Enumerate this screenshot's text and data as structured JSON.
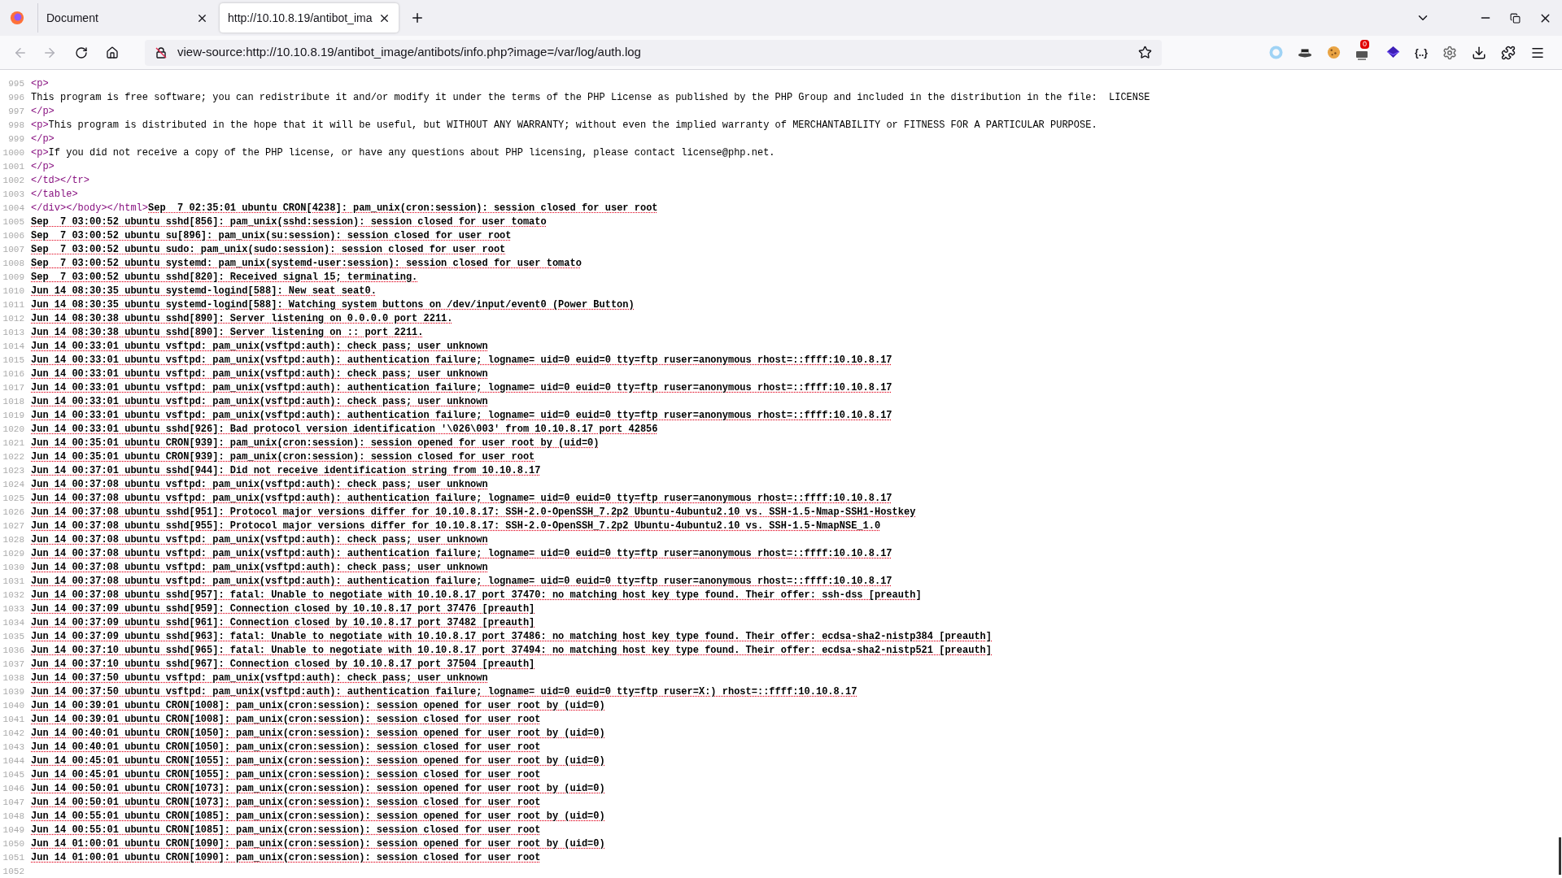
{
  "tabs": [
    {
      "title": "Document",
      "selected": false
    },
    {
      "title": "http://10.10.8.19/antibot_ima",
      "selected": true
    }
  ],
  "address_bar": {
    "url": "view-source:http://10.10.8.19/antibot_image/antibots/info.php?image=/var/log/auth.log"
  },
  "extensions": {
    "badge": "0",
    "json_label": "{..}"
  },
  "source_lines": [
    {
      "number": "995",
      "parts": [
        {
          "kind": "tag",
          "text": "<p>"
        }
      ]
    },
    {
      "number": "996",
      "parts": [
        {
          "kind": "text",
          "text": "This program is free software; you can redistribute it and/or modify it under the terms of the PHP License as published by the PHP Group and included in the distribution in the file:  LICENSE"
        }
      ]
    },
    {
      "number": "997",
      "parts": [
        {
          "kind": "tag",
          "text": "</p>"
        }
      ]
    },
    {
      "number": "998",
      "parts": [
        {
          "kind": "tag",
          "text": "<p>"
        },
        {
          "kind": "text",
          "text": "This program is distributed in the hope that it will be useful, but WITHOUT ANY WARRANTY; without even the implied warranty of MERCHANTABILITY or FITNESS FOR A PARTICULAR PURPOSE."
        }
      ]
    },
    {
      "number": "999",
      "parts": [
        {
          "kind": "tag",
          "text": "</p>"
        }
      ]
    },
    {
      "number": "1000",
      "parts": [
        {
          "kind": "tag",
          "text": "<p>"
        },
        {
          "kind": "text",
          "text": "If you did not receive a copy of the PHP license, or have any questions about PHP licensing, please contact license@php.net."
        }
      ]
    },
    {
      "number": "1001",
      "parts": [
        {
          "kind": "tag",
          "text": "</p>"
        }
      ]
    },
    {
      "number": "1002",
      "parts": [
        {
          "kind": "tag",
          "text": "</td></tr>"
        }
      ]
    },
    {
      "number": "1003",
      "parts": [
        {
          "kind": "tag",
          "text": "</table>"
        }
      ]
    },
    {
      "number": "1004",
      "parts": [
        {
          "kind": "tag",
          "text": "</div></body></html>"
        },
        {
          "kind": "error",
          "text": "Sep  7 02:35:01 ubuntu CRON[4238]: pam_unix(cron:session): session closed for user root"
        }
      ]
    },
    {
      "number": "1005",
      "parts": [
        {
          "kind": "error",
          "text": "Sep  7 03:00:52 ubuntu sshd[856]: pam_unix(sshd:session): session closed for user tomato"
        }
      ]
    },
    {
      "number": "1006",
      "parts": [
        {
          "kind": "error",
          "text": "Sep  7 03:00:52 ubuntu su[896]: pam_unix(su:session): session closed for user root"
        }
      ]
    },
    {
      "number": "1007",
      "parts": [
        {
          "kind": "error",
          "text": "Sep  7 03:00:52 ubuntu sudo: pam_unix(sudo:session): session closed for user root"
        }
      ]
    },
    {
      "number": "1008",
      "parts": [
        {
          "kind": "error",
          "text": "Sep  7 03:00:52 ubuntu systemd: pam_unix(systemd-user:session): session closed for user tomato"
        }
      ]
    },
    {
      "number": "1009",
      "parts": [
        {
          "kind": "error",
          "text": "Sep  7 03:00:52 ubuntu sshd[820]: Received signal 15; terminating."
        }
      ]
    },
    {
      "number": "1010",
      "parts": [
        {
          "kind": "error",
          "text": "Jun 14 08:30:35 ubuntu systemd-logind[588]: New seat seat0."
        }
      ]
    },
    {
      "number": "1011",
      "parts": [
        {
          "kind": "error",
          "text": "Jun 14 08:30:35 ubuntu systemd-logind[588]: Watching system buttons on /dev/input/event0 (Power Button)"
        }
      ]
    },
    {
      "number": "1012",
      "parts": [
        {
          "kind": "error",
          "text": "Jun 14 08:30:38 ubuntu sshd[890]: Server listening on 0.0.0.0 port 2211."
        }
      ]
    },
    {
      "number": "1013",
      "parts": [
        {
          "kind": "error",
          "text": "Jun 14 08:30:38 ubuntu sshd[890]: Server listening on :: port 2211."
        }
      ]
    },
    {
      "number": "1014",
      "parts": [
        {
          "kind": "error",
          "text": "Jun 14 00:33:01 ubuntu vsftpd: pam_unix(vsftpd:auth): check pass; user unknown"
        }
      ]
    },
    {
      "number": "1015",
      "parts": [
        {
          "kind": "error",
          "text": "Jun 14 00:33:01 ubuntu vsftpd: pam_unix(vsftpd:auth): authentication failure; logname= uid=0 euid=0 tty=ftp ruser=anonymous rhost=::ffff:10.10.8.17"
        }
      ]
    },
    {
      "number": "1016",
      "parts": [
        {
          "kind": "error",
          "text": "Jun 14 00:33:01 ubuntu vsftpd: pam_unix(vsftpd:auth): check pass; user unknown"
        }
      ]
    },
    {
      "number": "1017",
      "parts": [
        {
          "kind": "error",
          "text": "Jun 14 00:33:01 ubuntu vsftpd: pam_unix(vsftpd:auth): authentication failure; logname= uid=0 euid=0 tty=ftp ruser=anonymous rhost=::ffff:10.10.8.17"
        }
      ]
    },
    {
      "number": "1018",
      "parts": [
        {
          "kind": "error",
          "text": "Jun 14 00:33:01 ubuntu vsftpd: pam_unix(vsftpd:auth): check pass; user unknown"
        }
      ]
    },
    {
      "number": "1019",
      "parts": [
        {
          "kind": "error",
          "text": "Jun 14 00:33:01 ubuntu vsftpd: pam_unix(vsftpd:auth): authentication failure; logname= uid=0 euid=0 tty=ftp ruser=anonymous rhost=::ffff:10.10.8.17"
        }
      ]
    },
    {
      "number": "1020",
      "parts": [
        {
          "kind": "error",
          "text": "Jun 14 00:33:01 ubuntu sshd[926]: Bad protocol version identification '\\026\\003' from 10.10.8.17 port 42856"
        }
      ]
    },
    {
      "number": "1021",
      "parts": [
        {
          "kind": "error",
          "text": "Jun 14 00:35:01 ubuntu CRON[939]: pam_unix(cron:session): session opened for user root by (uid=0)"
        }
      ]
    },
    {
      "number": "1022",
      "parts": [
        {
          "kind": "error",
          "text": "Jun 14 00:35:01 ubuntu CRON[939]: pam_unix(cron:session): session closed for user root"
        }
      ]
    },
    {
      "number": "1023",
      "parts": [
        {
          "kind": "error",
          "text": "Jun 14 00:37:01 ubuntu sshd[944]: Did not receive identification string from 10.10.8.17"
        }
      ]
    },
    {
      "number": "1024",
      "parts": [
        {
          "kind": "error",
          "text": "Jun 14 00:37:08 ubuntu vsftpd: pam_unix(vsftpd:auth): check pass; user unknown"
        }
      ]
    },
    {
      "number": "1025",
      "parts": [
        {
          "kind": "error",
          "text": "Jun 14 00:37:08 ubuntu vsftpd: pam_unix(vsftpd:auth): authentication failure; logname= uid=0 euid=0 tty=ftp ruser=anonymous rhost=::ffff:10.10.8.17"
        }
      ]
    },
    {
      "number": "1026",
      "parts": [
        {
          "kind": "error",
          "text": "Jun 14 00:37:08 ubuntu sshd[951]: Protocol major versions differ for 10.10.8.17: SSH-2.0-OpenSSH_7.2p2 Ubuntu-4ubuntu2.10 vs. SSH-1.5-Nmap-SSH1-Hostkey"
        }
      ]
    },
    {
      "number": "1027",
      "parts": [
        {
          "kind": "error",
          "text": "Jun 14 00:37:08 ubuntu sshd[955]: Protocol major versions differ for 10.10.8.17: SSH-2.0-OpenSSH_7.2p2 Ubuntu-4ubuntu2.10 vs. SSH-1.5-NmapNSE_1.0"
        }
      ]
    },
    {
      "number": "1028",
      "parts": [
        {
          "kind": "error",
          "text": "Jun 14 00:37:08 ubuntu vsftpd: pam_unix(vsftpd:auth): check pass; user unknown"
        }
      ]
    },
    {
      "number": "1029",
      "parts": [
        {
          "kind": "error",
          "text": "Jun 14 00:37:08 ubuntu vsftpd: pam_unix(vsftpd:auth): authentication failure; logname= uid=0 euid=0 tty=ftp ruser=anonymous rhost=::ffff:10.10.8.17"
        }
      ]
    },
    {
      "number": "1030",
      "parts": [
        {
          "kind": "error",
          "text": "Jun 14 00:37:08 ubuntu vsftpd: pam_unix(vsftpd:auth): check pass; user unknown"
        }
      ]
    },
    {
      "number": "1031",
      "parts": [
        {
          "kind": "error",
          "text": "Jun 14 00:37:08 ubuntu vsftpd: pam_unix(vsftpd:auth): authentication failure; logname= uid=0 euid=0 tty=ftp ruser=anonymous rhost=::ffff:10.10.8.17"
        }
      ]
    },
    {
      "number": "1032",
      "parts": [
        {
          "kind": "error",
          "text": "Jun 14 00:37:08 ubuntu sshd[957]: fatal: Unable to negotiate with 10.10.8.17 port 37470: no matching host key type found. Their offer: ssh-dss [preauth]"
        }
      ]
    },
    {
      "number": "1033",
      "parts": [
        {
          "kind": "error",
          "text": "Jun 14 00:37:09 ubuntu sshd[959]: Connection closed by 10.10.8.17 port 37476 [preauth]"
        }
      ]
    },
    {
      "number": "1034",
      "parts": [
        {
          "kind": "error",
          "text": "Jun 14 00:37:09 ubuntu sshd[961]: Connection closed by 10.10.8.17 port 37482 [preauth]"
        }
      ]
    },
    {
      "number": "1035",
      "parts": [
        {
          "kind": "error",
          "text": "Jun 14 00:37:09 ubuntu sshd[963]: fatal: Unable to negotiate with 10.10.8.17 port 37486: no matching host key type found. Their offer: ecdsa-sha2-nistp384 [preauth]"
        }
      ]
    },
    {
      "number": "1036",
      "parts": [
        {
          "kind": "error",
          "text": "Jun 14 00:37:10 ubuntu sshd[965]: fatal: Unable to negotiate with 10.10.8.17 port 37494: no matching host key type found. Their offer: ecdsa-sha2-nistp521 [preauth]"
        }
      ]
    },
    {
      "number": "1037",
      "parts": [
        {
          "kind": "error",
          "text": "Jun 14 00:37:10 ubuntu sshd[967]: Connection closed by 10.10.8.17 port 37504 [preauth]"
        }
      ]
    },
    {
      "number": "1038",
      "parts": [
        {
          "kind": "error",
          "text": "Jun 14 00:37:50 ubuntu vsftpd: pam_unix(vsftpd:auth): check pass; user unknown"
        }
      ]
    },
    {
      "number": "1039",
      "parts": [
        {
          "kind": "error",
          "text": "Jun 14 00:37:50 ubuntu vsftpd: pam_unix(vsftpd:auth): authentication failure; logname= uid=0 euid=0 tty=ftp ruser=X:) rhost=::ffff:10.10.8.17"
        }
      ]
    },
    {
      "number": "1040",
      "parts": [
        {
          "kind": "error",
          "text": "Jun 14 00:39:01 ubuntu CRON[1008]: pam_unix(cron:session): session opened for user root by (uid=0)"
        }
      ]
    },
    {
      "number": "1041",
      "parts": [
        {
          "kind": "error",
          "text": "Jun 14 00:39:01 ubuntu CRON[1008]: pam_unix(cron:session): session closed for user root"
        }
      ]
    },
    {
      "number": "1042",
      "parts": [
        {
          "kind": "error",
          "text": "Jun 14 00:40:01 ubuntu CRON[1050]: pam_unix(cron:session): session opened for user root by (uid=0)"
        }
      ]
    },
    {
      "number": "1043",
      "parts": [
        {
          "kind": "error",
          "text": "Jun 14 00:40:01 ubuntu CRON[1050]: pam_unix(cron:session): session closed for user root"
        }
      ]
    },
    {
      "number": "1044",
      "parts": [
        {
          "kind": "error",
          "text": "Jun 14 00:45:01 ubuntu CRON[1055]: pam_unix(cron:session): session opened for user root by (uid=0)"
        }
      ]
    },
    {
      "number": "1045",
      "parts": [
        {
          "kind": "error",
          "text": "Jun 14 00:45:01 ubuntu CRON[1055]: pam_unix(cron:session): session closed for user root"
        }
      ]
    },
    {
      "number": "1046",
      "parts": [
        {
          "kind": "error",
          "text": "Jun 14 00:50:01 ubuntu CRON[1073]: pam_unix(cron:session): session opened for user root by (uid=0)"
        }
      ]
    },
    {
      "number": "1047",
      "parts": [
        {
          "kind": "error",
          "text": "Jun 14 00:50:01 ubuntu CRON[1073]: pam_unix(cron:session): session closed for user root"
        }
      ]
    },
    {
      "number": "1048",
      "parts": [
        {
          "kind": "error",
          "text": "Jun 14 00:55:01 ubuntu CRON[1085]: pam_unix(cron:session): session opened for user root by (uid=0)"
        }
      ]
    },
    {
      "number": "1049",
      "parts": [
        {
          "kind": "error",
          "text": "Jun 14 00:55:01 ubuntu CRON[1085]: pam_unix(cron:session): session closed for user root"
        }
      ]
    },
    {
      "number": "1050",
      "parts": [
        {
          "kind": "error",
          "text": "Jun 14 01:00:01 ubuntu CRON[1090]: pam_unix(cron:session): session opened for user root by (uid=0)"
        }
      ]
    },
    {
      "number": "1051",
      "parts": [
        {
          "kind": "error",
          "text": "Jun 14 01:00:01 ubuntu CRON[1090]: pam_unix(cron:session): session closed for user root"
        }
      ]
    },
    {
      "number": "1052"
    }
  ]
}
